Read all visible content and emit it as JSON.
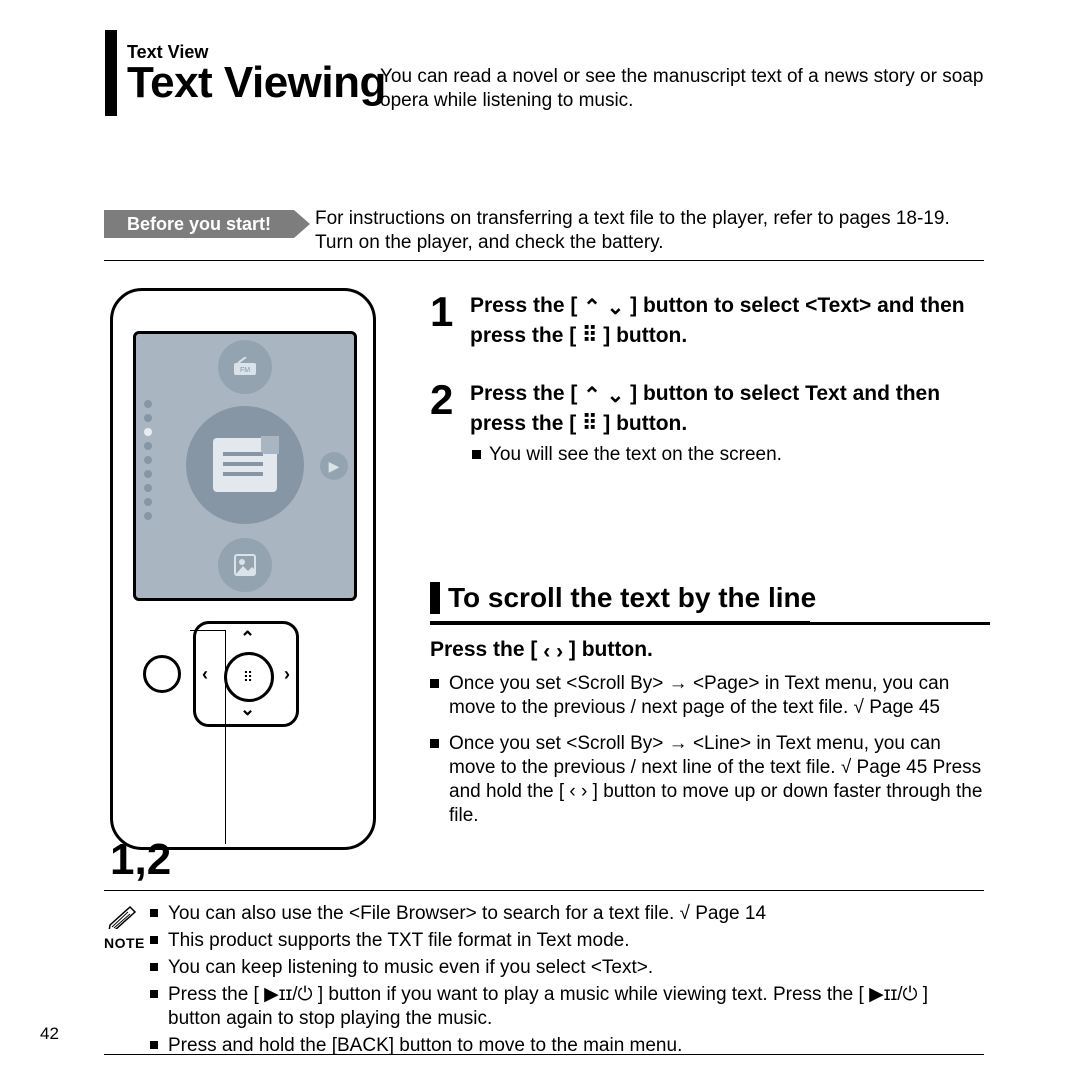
{
  "header": {
    "breadcrumb": "Text View",
    "title": "Text Viewing",
    "intro": "You can read a novel or see the manuscript text of a news story or soap opera while listening to music."
  },
  "before_you_start": {
    "label": "Before you start!",
    "text": "For instructions on transferring a text file to the player, refer to pages 18-19. Turn on the player, and check the battery."
  },
  "steps": [
    {
      "num": "1",
      "bold_pre": "Press the [ ",
      "bold_post": " ] button to select <Text> and then press the [ ⠿ ] button."
    },
    {
      "num": "2",
      "bold_pre": "Press the [ ",
      "bold_post": " ] button to select Text and then press the [ ⠿ ] button.",
      "sub": "You will see the text on the screen."
    }
  ],
  "subsection": {
    "title": "To scroll the text by the line",
    "press_pre": "Press the [ ",
    "press_post": " ] button.",
    "items": [
      "Once you set <Scroll By> → <Page> in Text menu, you can move to the previous / next page of the text file.  √ Page 45",
      "Once you set <Scroll By> → <Line> in Text menu, you can move to the previous / next line of the text file.  √ Page 45  Press and hold the [ ‹ › ] button to move up or down faster through the file."
    ]
  },
  "note": {
    "label": "NOTE",
    "items": [
      "You can also use the <File Browser> to search for a text file. √ Page 14",
      "This product supports the TXT file format in Text mode.",
      "You can keep listening to music even if you select <Text>.",
      "Press the [ ▶ɪɪ/⏻ ] button if you want to play a music while viewing text. Press the [ ▶ɪɪ/⏻ ] button again to stop playing the music.",
      "Press and hold the [BACK] button to move to the main menu."
    ]
  },
  "device": {
    "step_label": "1,2",
    "fm_label": "FM",
    "play_glyph": "▶"
  },
  "page_number": "42",
  "glyphs": {
    "up": "⌃",
    "down": "⌄",
    "left": "‹",
    "right": "›",
    "grid": "⠿"
  }
}
